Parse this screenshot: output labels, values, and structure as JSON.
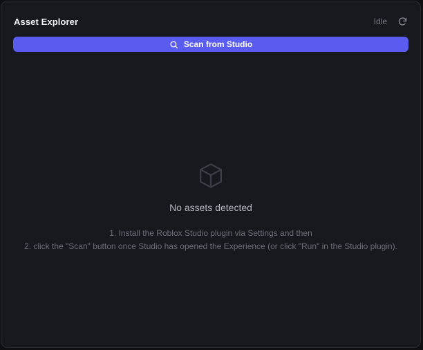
{
  "header": {
    "title": "Asset Explorer",
    "status": "Idle",
    "refresh_icon": "refresh-icon"
  },
  "scan_button": {
    "label": "Scan from Studio",
    "icon": "search-icon"
  },
  "empty_state": {
    "icon": "cube-icon",
    "title": "No assets detected",
    "steps": [
      "1. Install the Roblox Studio plugin via Settings and then",
      "2. click the \"Scan\" button once Studio has opened the Experience (or click \"Run\" in the Studio plugin)."
    ]
  },
  "colors": {
    "background": "#18181f",
    "accent": "#5a5cf0",
    "text_primary": "#f1f1f4",
    "text_muted": "#6e6e79"
  }
}
